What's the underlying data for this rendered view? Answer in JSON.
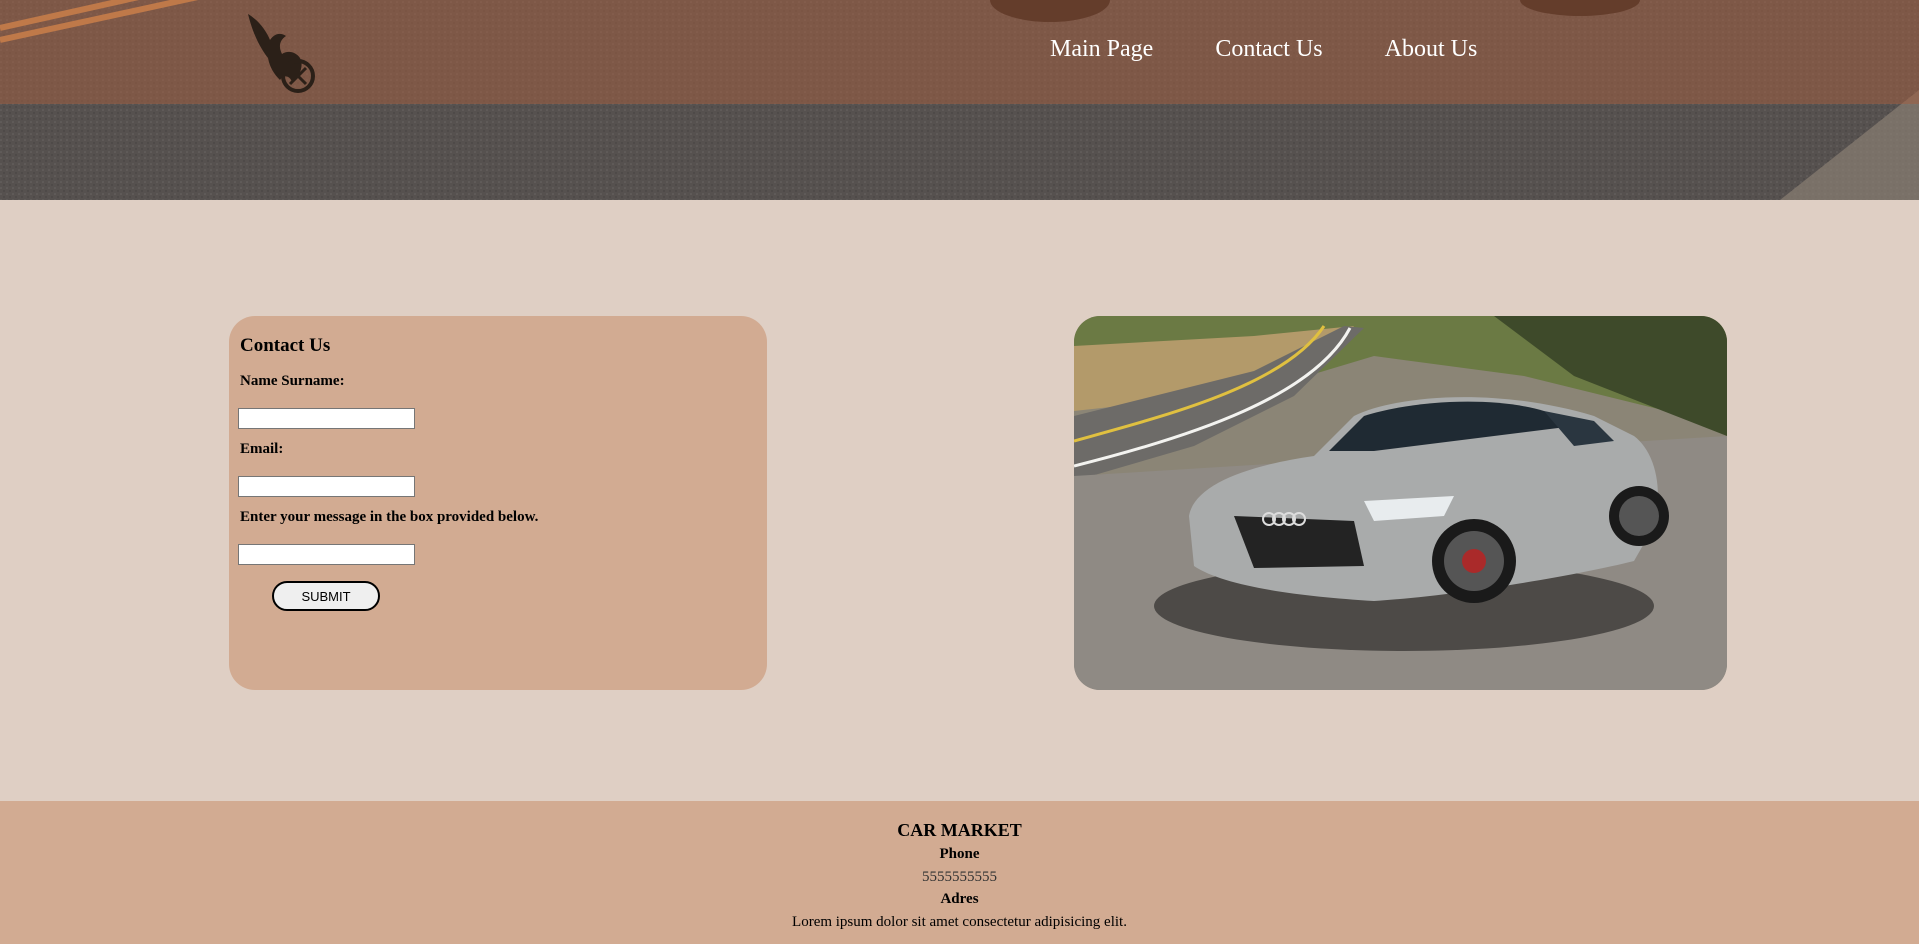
{
  "nav": {
    "items": [
      {
        "label": "Main Page"
      },
      {
        "label": "Contact Us"
      },
      {
        "label": "About Us"
      }
    ]
  },
  "logo": {
    "icon": "eagle-icon"
  },
  "contact_form": {
    "title": "Contact Us",
    "name_label": "Name Surname:",
    "name_value": "",
    "email_label": "Email:",
    "email_value": "",
    "message_label": "Enter your message in the box provided below.",
    "message_value": "",
    "submit_label": "SUBMIT"
  },
  "car_image": {
    "alt": "car-photo"
  },
  "footer": {
    "brand": "CAR MARKET",
    "phone_label": "Phone",
    "phone_value": "5555555555",
    "address_label": "Adres",
    "address_value": "Lorem ipsum dolor sit amet consectetur adipisicing elit."
  },
  "colors": {
    "page_background": "#dfcfc4",
    "card_background": "#d2ab92",
    "footer_background": "#d2ab92",
    "nav_text": "#ffffff"
  }
}
